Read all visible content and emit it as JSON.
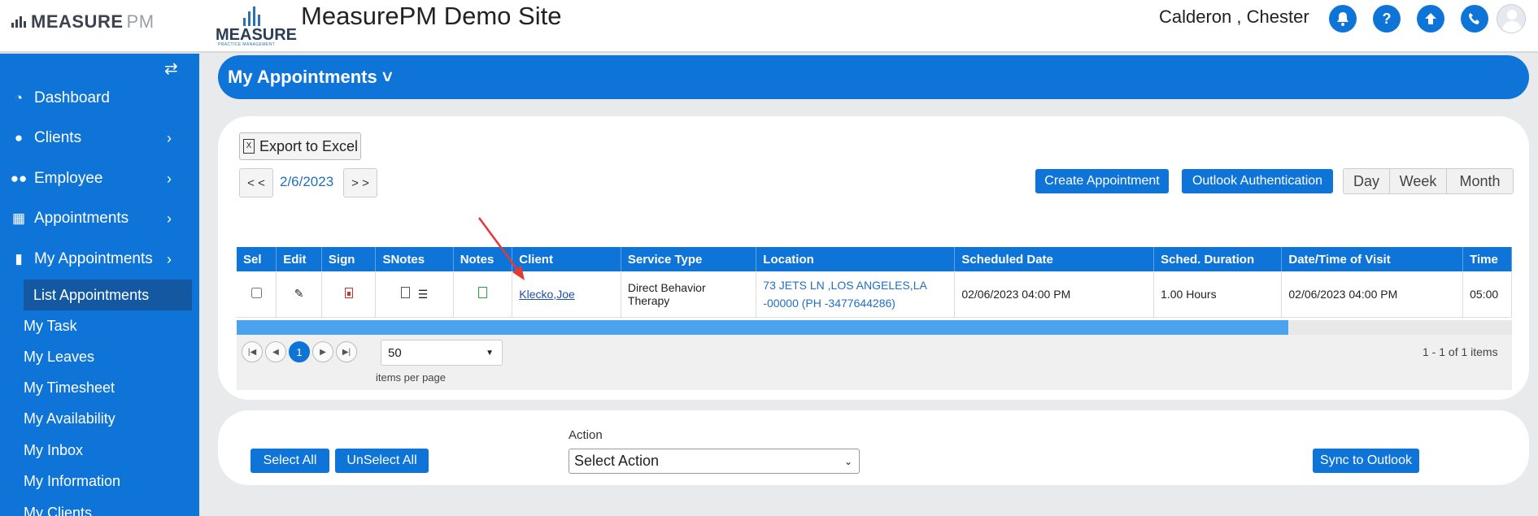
{
  "header": {
    "brand": "MEASURE",
    "brand_suffix": "PM",
    "practice_logo": "MEASURE",
    "practice_logo_sub": "PRACTICE MANAGEMENT",
    "site_title": "MeasurePM Demo Site",
    "user_name": "Calderon , Chester",
    "icons": [
      "bell-icon",
      "help-icon",
      "upload-icon",
      "phone-icon"
    ]
  },
  "sidebar": {
    "items": [
      {
        "label": "Dashboard",
        "icon": "dashboard-icon"
      },
      {
        "label": "Clients",
        "icon": "user-icon"
      },
      {
        "label": "Employee",
        "icon": "users-icon"
      },
      {
        "label": "Appointments",
        "icon": "calendar-icon"
      },
      {
        "label": "My Appointments",
        "icon": "book-icon"
      }
    ],
    "sub_items": [
      "List Appointments",
      "My Task",
      "My Leaves",
      "My Timesheet",
      "My Availability",
      "My Inbox",
      "My Information",
      "My Clients"
    ]
  },
  "page": {
    "title": "My Appointments"
  },
  "toolbar": {
    "export_label": "Export to Excel",
    "prev_label": "< <",
    "next_label": "> >",
    "current_date": "2/6/2023",
    "create_label": "Create Appointment",
    "outlook_auth_label": "Outlook Authentication",
    "view_day": "Day",
    "view_week": "Week",
    "view_month": "Month"
  },
  "table": {
    "columns": [
      "Sel",
      "Edit",
      "Sign",
      "SNotes",
      "Notes",
      "Client",
      "Service Type",
      "Location",
      "Scheduled Date",
      "Sched. Duration",
      "Date/Time of Visit",
      "Time"
    ],
    "rows": [
      {
        "client": "Klecko,Joe",
        "service_type": "Direct Behavior Therapy",
        "location": "73 JETS LN ,LOS ANGELES,LA -00000 (PH -3477644286)",
        "scheduled_date": "02/06/2023 04:00 PM",
        "duration": "1.00 Hours",
        "visit": "02/06/2023 04:00 PM",
        "time": "05:00"
      }
    ]
  },
  "pager": {
    "current_page": "1",
    "page_size": "50",
    "items_per_page_label": "items per page",
    "summary": "1 - 1 of 1 items"
  },
  "actions": {
    "select_all": "Select All",
    "unselect_all": "UnSelect All",
    "action_label": "Action",
    "action_placeholder": "Select Action",
    "sync_label": "Sync to Outlook"
  },
  "colors": {
    "primary": "#0f74d8",
    "sidebar_active": "#1358a0",
    "annotation_arrow": "#e53935"
  }
}
